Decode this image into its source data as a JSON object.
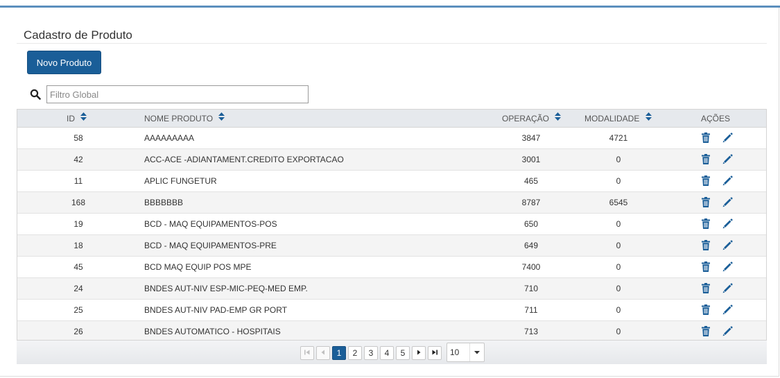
{
  "page": {
    "title": "Cadastro de Produto"
  },
  "toolbar": {
    "new_label": "Novo Produto"
  },
  "search": {
    "placeholder": "Filtro Global",
    "value": ""
  },
  "table": {
    "columns": {
      "id": "ID",
      "nome": "NOME PRODUTO",
      "operacao": "OPERAÇÃO",
      "modalidade": "MODALIDADE",
      "acoes": "AÇÕES"
    },
    "rows": [
      {
        "id": "58",
        "nome": "AAAAAAAAA",
        "operacao": "3847",
        "modalidade": "4721"
      },
      {
        "id": "42",
        "nome": "ACC-ACE -ADIANTAMENT.CREDITO EXPORTACAO",
        "operacao": "3001",
        "modalidade": "0"
      },
      {
        "id": "11",
        "nome": "APLIC FUNGETUR",
        "operacao": "465",
        "modalidade": "0"
      },
      {
        "id": "168",
        "nome": "BBBBBBB",
        "operacao": "8787",
        "modalidade": "6545"
      },
      {
        "id": "19",
        "nome": "BCD - MAQ EQUIPAMENTOS-POS",
        "operacao": "650",
        "modalidade": "0"
      },
      {
        "id": "18",
        "nome": "BCD - MAQ EQUIPAMENTOS-PRE",
        "operacao": "649",
        "modalidade": "0"
      },
      {
        "id": "45",
        "nome": "BCD MAQ EQUIP POS MPE",
        "operacao": "7400",
        "modalidade": "0"
      },
      {
        "id": "24",
        "nome": "BNDES AUT-NIV ESP-MIC-PEQ-MED EMP.",
        "operacao": "710",
        "modalidade": "0"
      },
      {
        "id": "25",
        "nome": "BNDES AUT-NIV PAD-EMP GR PORT",
        "operacao": "711",
        "modalidade": "0"
      },
      {
        "id": "26",
        "nome": "BNDES AUTOMATICO - HOSPITAIS",
        "operacao": "713",
        "modalidade": "0"
      }
    ],
    "row_actions": [
      "trash-icon",
      "pencil-icon"
    ]
  },
  "pagination": {
    "pages": [
      "1",
      "2",
      "3",
      "4",
      "5"
    ],
    "current": "1",
    "rows_per_page": "10"
  },
  "colors": {
    "primary": "#1a5e98",
    "accent_bar": "#5b8fbd",
    "icon": "#1a5e98"
  }
}
